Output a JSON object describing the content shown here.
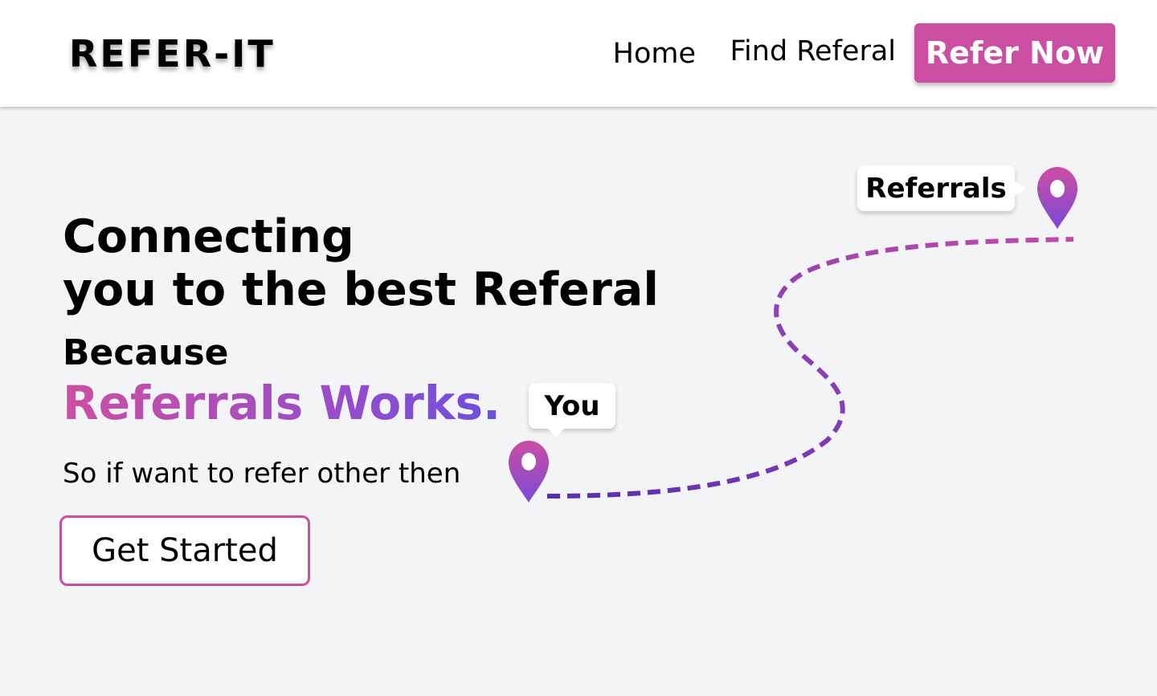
{
  "brand": {
    "logo": "REFER-IT"
  },
  "nav": {
    "home": "Home",
    "find_referral": "Find Referal",
    "cta": "Refer Now"
  },
  "hero": {
    "title_line1": "Connecting",
    "title_line2": "you to the best Referal",
    "because": "Because",
    "highlight": "Referrals Works.",
    "subtext": "So if want to refer other then",
    "button": "Get Started"
  },
  "map": {
    "start_label": "You",
    "end_label": "Referrals",
    "start_icon": "map-pin-icon",
    "end_icon": "map-pin-icon"
  },
  "colors": {
    "accent": "#cc4ea3",
    "gradient_end": "#6b4ee0",
    "background": "#f3f4f6",
    "navbar": "#ffffff"
  }
}
